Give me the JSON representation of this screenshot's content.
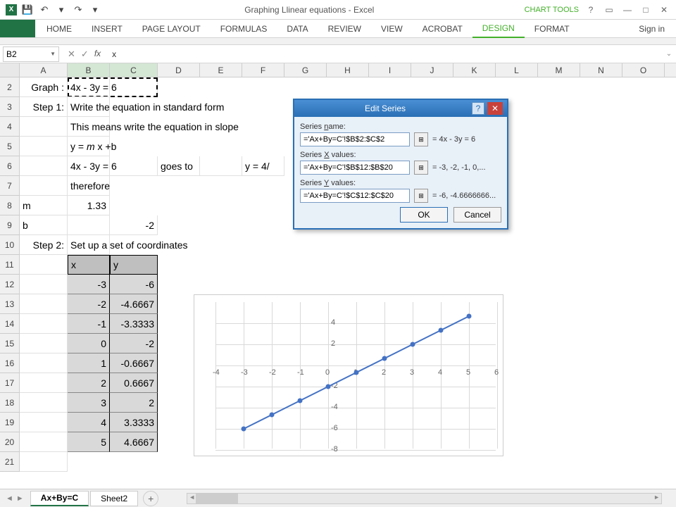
{
  "app": {
    "title": "Graphing Llinear equations - Excel",
    "chart_tools": "CHART TOOLS",
    "sign_in": "Sign in"
  },
  "qat": {
    "save": "💾",
    "undo": "↶",
    "redo": "↷"
  },
  "tabs": {
    "home": "HOME",
    "insert": "INSERT",
    "page_layout": "PAGE LAYOUT",
    "formulas": "FORMULAS",
    "data": "DATA",
    "review": "REVIEW",
    "view": "VIEW",
    "acrobat": "ACROBAT",
    "design": "DESIGN",
    "format": "FORMAT"
  },
  "name_box": "B2",
  "formula": "x",
  "columns": [
    "A",
    "B",
    "C",
    "D",
    "E",
    "F",
    "G",
    "H",
    "I",
    "J",
    "K",
    "L",
    "M",
    "N",
    "O"
  ],
  "rows": {
    "r2": {
      "a": "Graph :",
      "b": "4x - 3y = 6"
    },
    "r3": {
      "a": "Step 1:",
      "b": "Write the equation in standard form"
    },
    "r4": {
      "b": "This means write the equation in slope"
    },
    "r5": {
      "b": "y = m x +b"
    },
    "r6": {
      "b": "4x - 3y = 6",
      "d": "goes to",
      "f": "y = 4/"
    },
    "r7": {
      "b": "therefore"
    },
    "r8": {
      "a": "m",
      "b": "1.33"
    },
    "r9": {
      "a": "b",
      "c": "-2"
    },
    "r10": {
      "a": "Step 2:",
      "b": "Set up a set of coordinates"
    },
    "r11": {
      "x": "x",
      "y": "y"
    }
  },
  "data_table": [
    {
      "x": "-3",
      "y": "-6"
    },
    {
      "x": "-2",
      "y": "-4.6667"
    },
    {
      "x": "-1",
      "y": "-3.3333"
    },
    {
      "x": "0",
      "y": "-2"
    },
    {
      "x": "1",
      "y": "-0.6667"
    },
    {
      "x": "2",
      "y": "0.6667"
    },
    {
      "x": "3",
      "y": "2"
    },
    {
      "x": "4",
      "y": "3.3333"
    },
    {
      "x": "5",
      "y": "4.6667"
    }
  ],
  "dialog": {
    "title": "Edit Series",
    "series_name_label": "Series name:",
    "series_name": "='Ax+By=C'!$B$2:$C$2",
    "series_name_preview": "= 4x - 3y = 6",
    "x_label": "Series X values:",
    "x_value": "='Ax+By=C'!$B$12:$B$20",
    "x_preview": "= -3, -2, -1, 0,...",
    "y_label": "Series Y values:",
    "y_value": "='Ax+By=C'!$C$12:$C$20",
    "y_preview": "= -6, -4.6666666...",
    "ok": "OK",
    "cancel": "Cancel"
  },
  "sheets": {
    "s1": "Ax+By=C",
    "s2": "Sheet2"
  },
  "chart_data": {
    "type": "line",
    "x": [
      -3,
      -2,
      -1,
      0,
      1,
      2,
      3,
      4,
      5
    ],
    "y": [
      -6,
      -4.6667,
      -3.3333,
      -2,
      -0.6667,
      0.6667,
      2,
      3.3333,
      4.6667
    ],
    "xlim": [
      -4,
      6
    ],
    "ylim": [
      -8,
      6
    ],
    "x_ticks": [
      -4,
      -3,
      -2,
      -1,
      0,
      1,
      2,
      3,
      4,
      5,
      6
    ],
    "y_ticks": [
      -8,
      -6,
      -4,
      -2,
      0,
      2,
      4
    ]
  }
}
